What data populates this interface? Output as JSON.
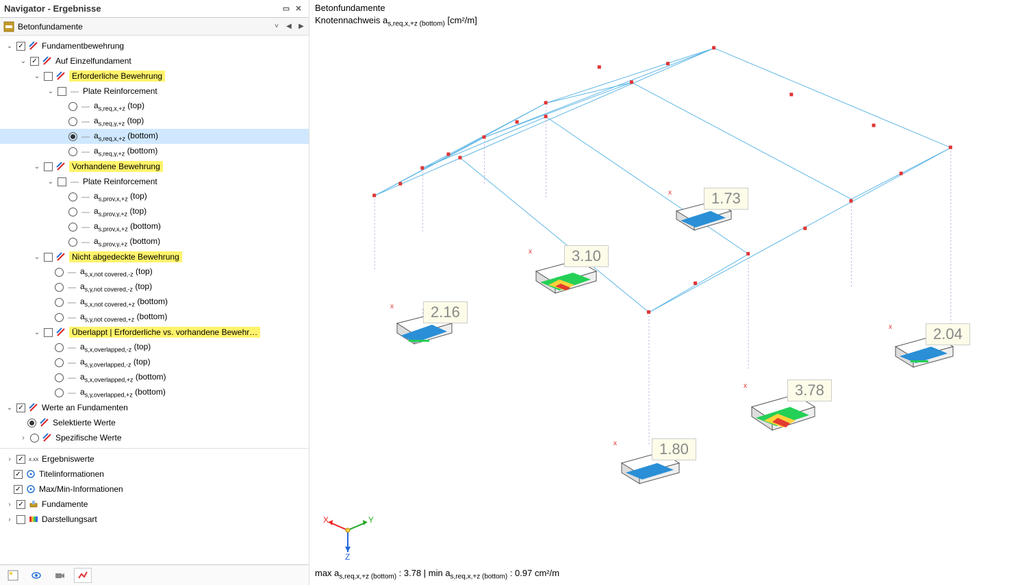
{
  "panel": {
    "title": "Navigator - Ergebnisse",
    "toolbar_label": "Betonfundamente"
  },
  "tree": {
    "root1": {
      "label": "Fundamentbewehrung",
      "child": {
        "label": "Auf Einzelfundament",
        "erf": {
          "label": "Erforderliche Bewehrung",
          "plate": {
            "label": "Plate Reinforcement"
          },
          "items": [
            "a_s,req,x,+z (top)",
            "a_s,req,y,+z (top)",
            "a_s,req,x,+z (bottom)",
            "a_s,req,y,+z (bottom)"
          ]
        },
        "vorh": {
          "label": "Vorhandene Bewehrung",
          "plate": {
            "label": "Plate Reinforcement"
          },
          "items": [
            "a_s,prov,x,+z (top)",
            "a_s,prov,y,+z (top)",
            "a_s,prov,x,+z (bottom)",
            "a_s,prov,y,+z (bottom)"
          ]
        },
        "nicht": {
          "label": "Nicht abgedeckte Bewehrung",
          "items": [
            "a_s,x,not covered,-z (top)",
            "a_s,y,not covered,-z (top)",
            "a_s,x,not covered,+z (bottom)",
            "a_s,y,not covered,+z (bottom)"
          ]
        },
        "ueber": {
          "label": "Überlappt | Erforderliche vs. vorhandene Bewehr…",
          "items": [
            "a_s,x,overlapped,-z (top)",
            "a_s,y,overlapped,-z (top)",
            "a_s,x,overlapped,+z (bottom)",
            "a_s,y,overlapped,+z (bottom)"
          ]
        }
      }
    },
    "werte": {
      "label": "Werte an Fundamenten",
      "sel": "Selektierte Werte",
      "spez": "Spezifische Werte"
    },
    "ergebniswerte": "Ergebniswerte",
    "titel": "Titelinformationen",
    "maxmin": "Max/Min-Informationen",
    "fund": "Fundamente",
    "darst": "Darstellungsart"
  },
  "viewport": {
    "title": "Betonfundamente",
    "subtitle_prefix": "Knotennachweis a",
    "subtitle_sub": "s,req,x,+z (bottom)",
    "subtitle_unit": " [cm²/m]",
    "status_prefix_max": "max a",
    "status_sub": "s,req,x,+z (bottom)",
    "status_maxval": " : 3.78 | min a",
    "status_minval": " : 0.97 cm²/m",
    "axes": {
      "x": "X",
      "y": "Y",
      "z": "Z"
    },
    "foundations": [
      {
        "value": "2.16"
      },
      {
        "value": "3.10"
      },
      {
        "value": "1.73"
      },
      {
        "value": "2.04"
      },
      {
        "value": "3.78"
      },
      {
        "value": "1.80"
      }
    ]
  }
}
